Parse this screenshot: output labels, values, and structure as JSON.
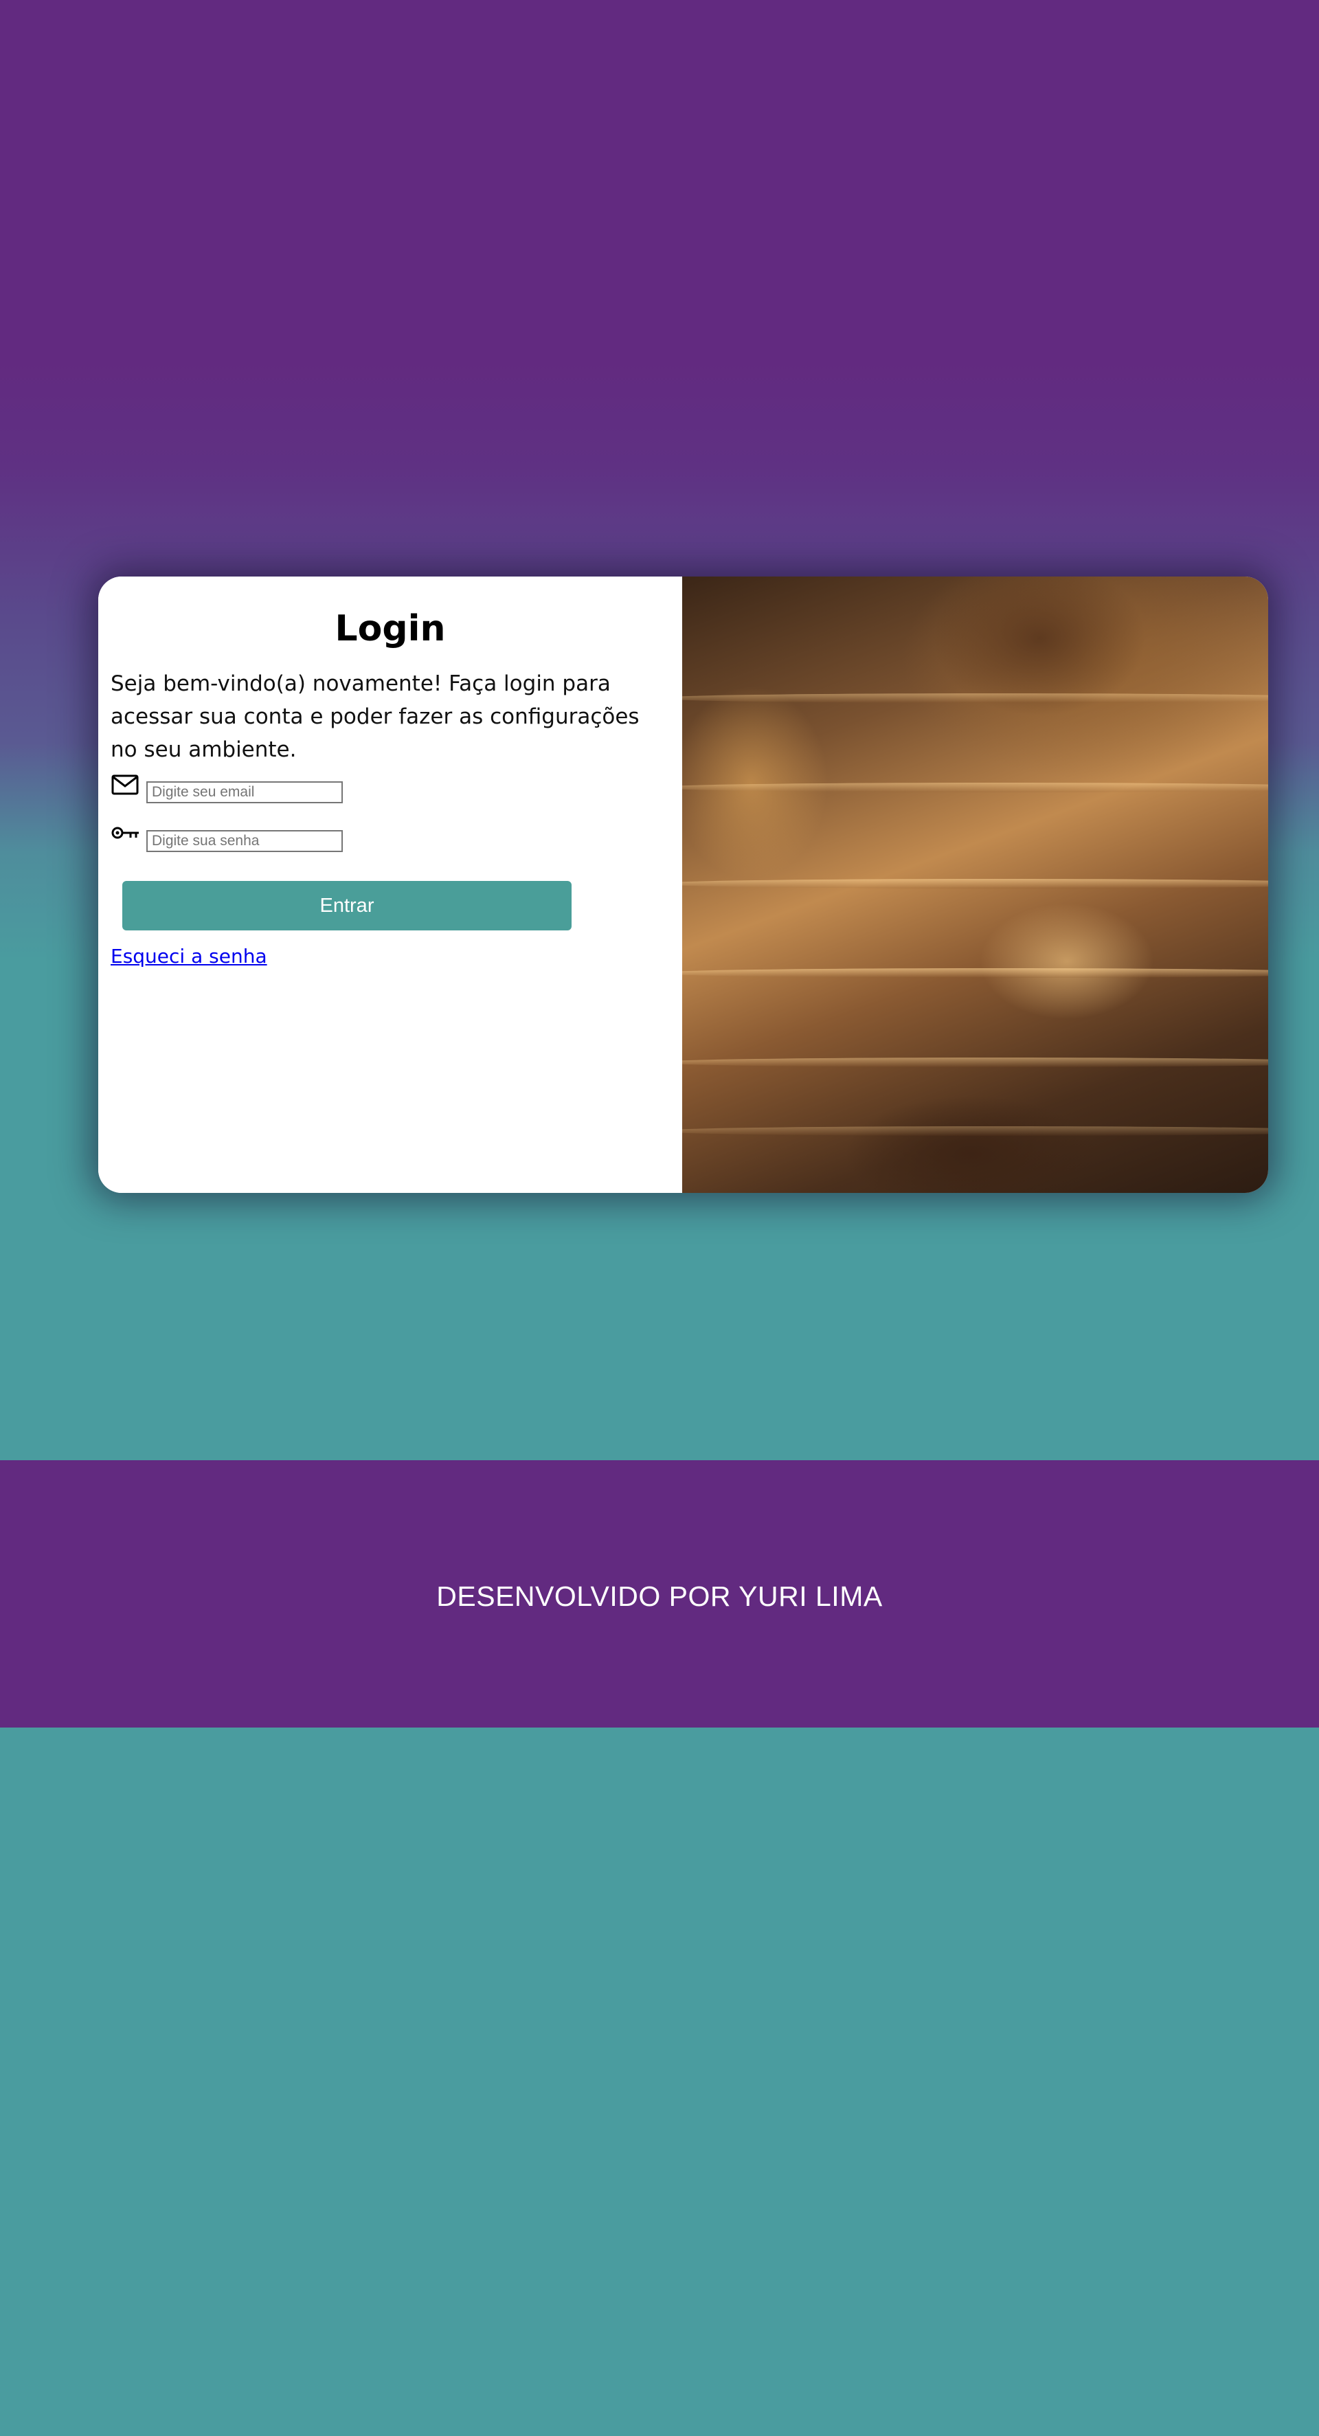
{
  "login": {
    "title": "Login",
    "welcome_text": "Seja bem-vindo(a) novamente! Faça login para acessar sua conta e poder fazer as configurações no seu ambiente.",
    "email": {
      "icon": "envelope-icon",
      "value": "",
      "placeholder": "Digite seu email"
    },
    "password": {
      "icon": "key-icon",
      "value": "",
      "placeholder": "Digite sua senha"
    },
    "submit_label": "Entrar",
    "forgot_link": "Esqueci a senha"
  },
  "hero_image": {
    "subject": "ornate-opera-house-interior-photo"
  },
  "footer": {
    "text": "DESENVOLVIDO POR YURI LIMA"
  },
  "colors": {
    "purple": "#622a80",
    "teal": "#4a9c9f",
    "button": "#4a9e99",
    "link": "#0000ee"
  }
}
